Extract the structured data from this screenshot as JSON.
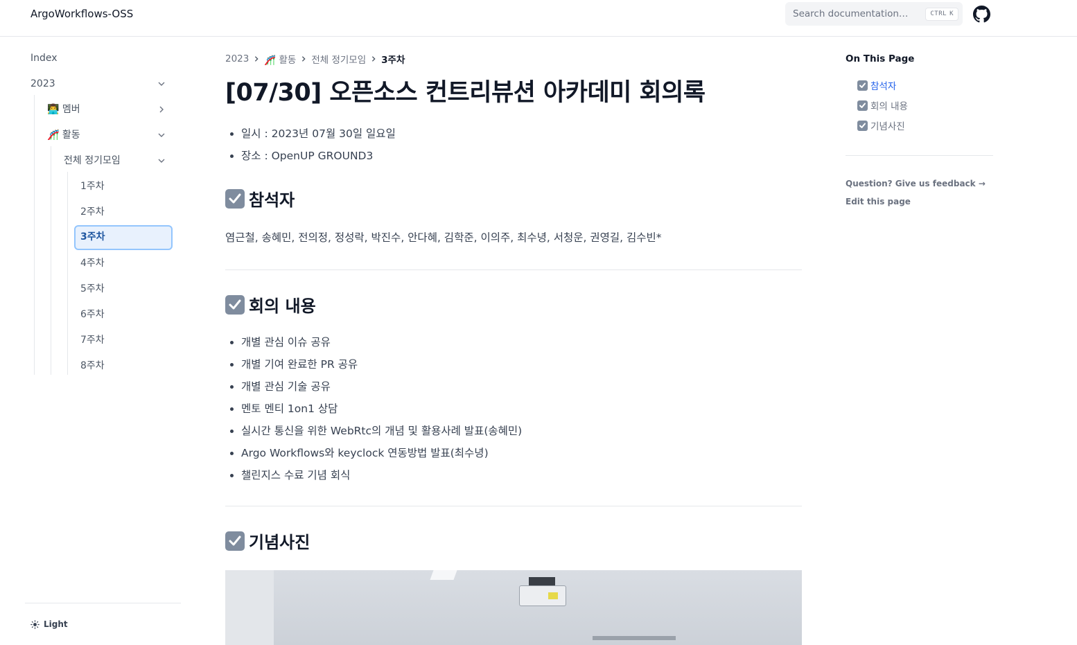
{
  "header": {
    "brand": "ArgoWorkflows-OSS",
    "search_placeholder": "Search documentation…",
    "search_shortcut_mod": "CTRL",
    "search_shortcut_key": "K",
    "github_icon": "github-icon"
  },
  "sidebar": {
    "items": [
      {
        "label": "Index"
      },
      {
        "label": "2023"
      },
      {
        "label": "👨‍💻 멤버"
      },
      {
        "label": "🎢 활동"
      },
      {
        "label": "전체 정기모임"
      },
      {
        "label": "1주차"
      },
      {
        "label": "2주차"
      },
      {
        "label": "3주차"
      },
      {
        "label": "4주차"
      },
      {
        "label": "5주차"
      },
      {
        "label": "6주차"
      },
      {
        "label": "7주차"
      },
      {
        "label": "8주차"
      }
    ],
    "active_item": "3주차",
    "theme_label": "Light"
  },
  "breadcrumb": [
    "2023",
    "🎢 활동",
    "전체 정기모임",
    "3주차"
  ],
  "page": {
    "title": "[07/30] 오픈소스 컨트리뷰션 아카데미 회의록",
    "meta": [
      "일시 : 2023년 07월 30일 일요일",
      "장소 : OpenUP GROUND3"
    ],
    "sections": {
      "attendees_heading": "참석자",
      "attendees": "염근철, 송혜민, 전의정, 정성락, 박진수, 안다혜, 김학준, 이의주, 최수녕, 서청운, 권영길, 김수빈*",
      "content_heading": "회의 내용",
      "content_items": [
        "개별 관심 이슈 공유",
        "개별 기여 완료한 PR 공유",
        "개별 관심 기술 공유",
        "멘토 멘티 1on1 상담",
        "실시간 통신을 위한 WebRtc의 개념 및 활용사례 발표(송혜민)",
        "Argo Workflows와 keyclock 연동방법 발표(최수녕)",
        "챌린지스 수료 기념 회식"
      ],
      "photo_heading": "기념사진"
    }
  },
  "toc": {
    "title": "On This Page",
    "items": [
      "참석자",
      "회의 내용",
      "기념사진"
    ],
    "active_index": 0,
    "feedback": "Question? Give us feedback →",
    "edit": "Edit this page"
  },
  "colors": {
    "accent": "#2563eb",
    "active_bg": "#e8f1fd",
    "check_bg": "#7f8c9e"
  }
}
